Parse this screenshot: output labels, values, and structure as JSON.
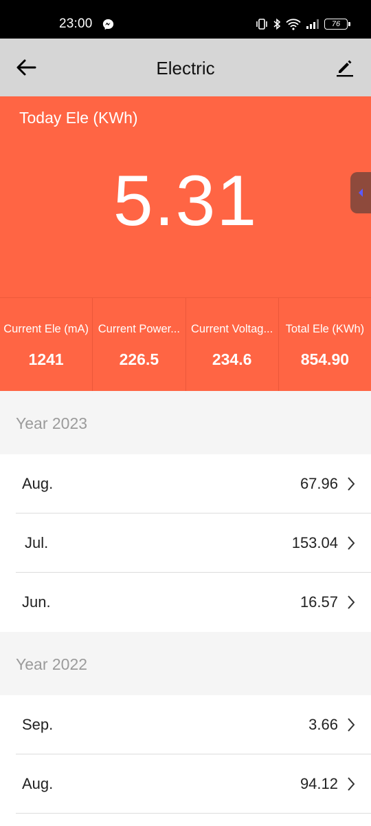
{
  "status_bar": {
    "time": "23:00",
    "battery": "76",
    "icons": [
      "messenger-icon",
      "vibrate-icon",
      "bluetooth-icon",
      "wifi-icon",
      "signal-icon",
      "battery-icon"
    ]
  },
  "header": {
    "title": "Electric",
    "back_icon": "arrow-left-icon",
    "edit_icon": "pencil-icon"
  },
  "hero": {
    "label": "Today Ele (KWh)",
    "value": "5.31",
    "side_tab_icon": "caret-left-icon"
  },
  "stats": [
    {
      "label": "Current Ele (mA)",
      "value": "1241"
    },
    {
      "label": "Current Power...",
      "value": "226.5"
    },
    {
      "label": "Current Voltag...",
      "value": "234.6"
    },
    {
      "label": "Total Ele (KWh)",
      "value": "854.90"
    }
  ],
  "history": [
    {
      "year": "Year 2023",
      "months": [
        {
          "name": "Aug.",
          "value": "67.96"
        },
        {
          "name": "Jul.",
          "value": "153.04"
        },
        {
          "name": "Jun.",
          "value": "16.57"
        }
      ]
    },
    {
      "year": "Year 2022",
      "months": [
        {
          "name": "Sep.",
          "value": "3.66"
        },
        {
          "name": "Aug.",
          "value": "94.12"
        }
      ]
    }
  ],
  "colors": {
    "accent": "#ff6544",
    "app_bar": "#d6d6d6",
    "section_bg": "#f5f5f5",
    "side_tab": "#8e4a3c",
    "side_tab_arrow": "#5a5aff"
  }
}
